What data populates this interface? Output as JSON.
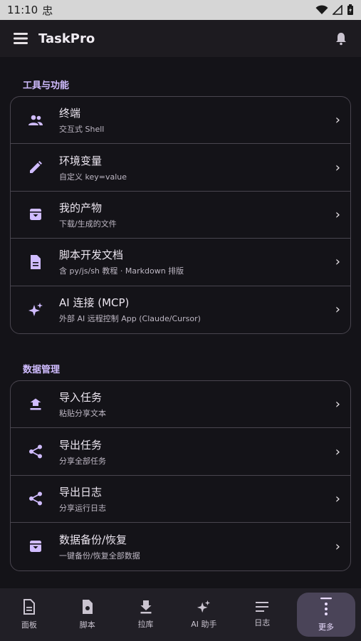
{
  "status": {
    "time": "11:10",
    "carrier_glyph": "忠"
  },
  "app": {
    "title": "TaskPro"
  },
  "sections": [
    {
      "title": "工具与功能",
      "items": [
        {
          "label": "终端",
          "sub": "交互式 Shell",
          "icon": "people-icon"
        },
        {
          "label": "环境变量",
          "sub": "自定义 key=value",
          "icon": "pencil-icon"
        },
        {
          "label": "我的产物",
          "sub": "下载/生成的文件",
          "icon": "archive-icon"
        },
        {
          "label": "脚本开发文档",
          "sub": "含 py/js/sh 教程 · Markdown 排版",
          "icon": "document-icon"
        },
        {
          "label": "AI 连接 (MCP)",
          "sub": "外部 AI 远程控制 App (Claude/Cursor)",
          "icon": "sparkle-icon"
        }
      ]
    },
    {
      "title": "数据管理",
      "items": [
        {
          "label": "导入任务",
          "sub": "粘贴分享文本",
          "icon": "upload-icon"
        },
        {
          "label": "导出任务",
          "sub": "分享全部任务",
          "icon": "share-icon"
        },
        {
          "label": "导出日志",
          "sub": "分享运行日志",
          "icon": "share-icon"
        },
        {
          "label": "数据备份/恢复",
          "sub": "一键备份/恢复全部数据",
          "icon": "archive-icon"
        }
      ]
    }
  ],
  "nav": [
    {
      "label": "面板",
      "icon": "panel-icon"
    },
    {
      "label": "脚本",
      "icon": "script-icon"
    },
    {
      "label": "拉库",
      "icon": "download-icon"
    },
    {
      "label": "AI 助手",
      "icon": "sparkle-icon"
    },
    {
      "label": "日志",
      "icon": "list-icon"
    },
    {
      "label": "更多",
      "icon": "more-icon",
      "active": true
    }
  ],
  "colors": {
    "accent": "#d0bcff",
    "background": "#141318",
    "card_border": "#49454f"
  }
}
